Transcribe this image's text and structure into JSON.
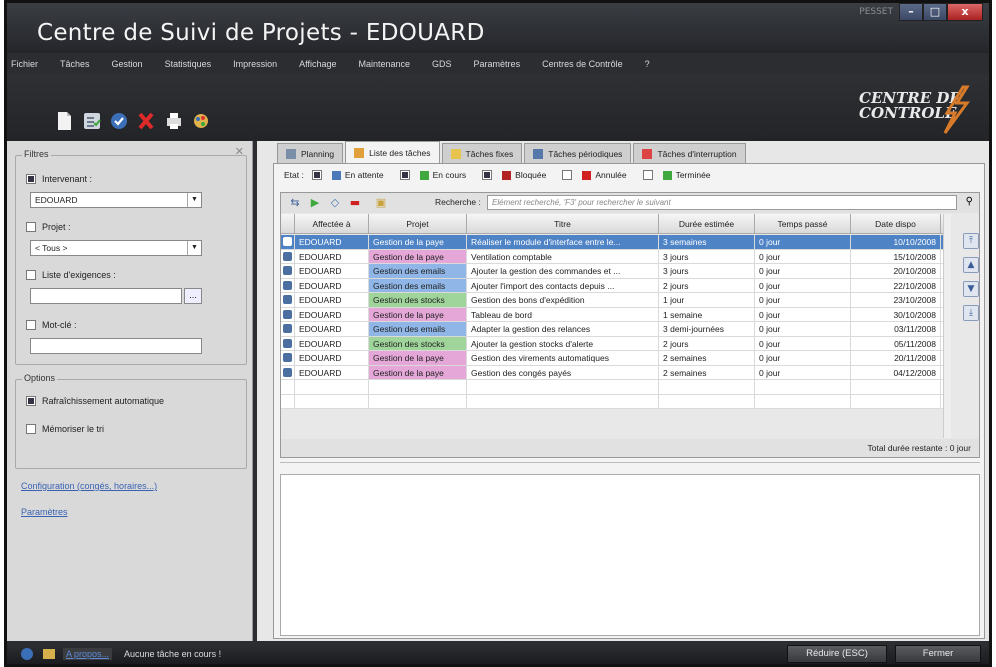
{
  "window": {
    "title": "Centre de Suivi de Projets - EDOUARD",
    "brand": "PESSET"
  },
  "menu": [
    "Fichier",
    "Tâches",
    "Gestion",
    "Statistiques",
    "Impression",
    "Affichage",
    "Maintenance",
    "GDS",
    "Paramètres",
    "Centres de Contrôle",
    "?"
  ],
  "toolbar": {
    "icons": [
      "new-document-icon",
      "validate-list-icon",
      "check-icon",
      "delete-icon",
      "print-icon",
      "settings-palette-icon"
    ],
    "logo_line1": "CENTRE DE",
    "logo_line2": "CONTROLE"
  },
  "filters": {
    "legend": "Filtres",
    "intervenant_label": "Intervenant :",
    "intervenant_checked": true,
    "intervenant_value": "EDOUARD",
    "projet_label": "Projet :",
    "projet_checked": false,
    "projet_value": "< Tous >",
    "exigences_label": "Liste d'exigences :",
    "exigences_checked": false,
    "exigences_browse": "...",
    "motcle_label": "Mot-clé :",
    "motcle_checked": false
  },
  "options": {
    "legend": "Options",
    "auto_refresh_label": "Rafraîchissement automatique",
    "auto_refresh_checked": true,
    "remember_sort_label": "Mémoriser le tri",
    "remember_sort_checked": false,
    "config_link": "Configuration (congés, horaires...)",
    "params_link": "Paramètres"
  },
  "tabs": [
    {
      "label": "Planning",
      "active": false
    },
    {
      "label": "Liste des tâches",
      "active": true
    },
    {
      "label": "Tâches fixes",
      "active": false
    },
    {
      "label": "Tâches périodiques",
      "active": false
    },
    {
      "label": "Tâches d'interruption",
      "active": false
    }
  ],
  "etat": {
    "label": "Etat :",
    "states": [
      {
        "label": "En attente",
        "checked": true,
        "color": "#4a78b8"
      },
      {
        "label": "En cours",
        "checked": true,
        "color": "#3fa83f"
      },
      {
        "label": "Bloquée",
        "checked": true,
        "color": "#b22222"
      },
      {
        "label": "Annulée",
        "checked": false,
        "color": "#d12020"
      },
      {
        "label": "Terminée",
        "checked": false,
        "color": "#3fa83f"
      }
    ]
  },
  "search": {
    "label": "Recherche :",
    "placeholder": "Elément recherché, 'F3' pour rechercher le suivant"
  },
  "grid": {
    "columns": [
      "Affectée à",
      "Projet",
      "Titre",
      "Durée estimée",
      "Temps passé",
      "Date dispo"
    ],
    "rows": [
      {
        "assignee": "EDOUARD",
        "projet": "Gestion de la paye",
        "titre": "Réaliser le module d'interface entre le...",
        "duree": "3 semaines",
        "temps": "0 jour",
        "date": "10/10/2008",
        "selected": true
      },
      {
        "assignee": "EDOUARD",
        "projet": "Gestion de la paye",
        "titre": "Ventilation comptable",
        "duree": "3 jours",
        "temps": "0 jour",
        "date": "15/10/2008",
        "selected": false
      },
      {
        "assignee": "EDOUARD",
        "projet": "Gestion des emails",
        "titre": "Ajouter la gestion des commandes et ...",
        "duree": "3 jours",
        "temps": "0 jour",
        "date": "20/10/2008",
        "selected": false
      },
      {
        "assignee": "EDOUARD",
        "projet": "Gestion des emails",
        "titre": "Ajouter l'import des contacts depuis ...",
        "duree": "2 jours",
        "temps": "0 jour",
        "date": "22/10/2008",
        "selected": false
      },
      {
        "assignee": "EDOUARD",
        "projet": "Gestion des stocks",
        "titre": "Gestion des bons d'expédition",
        "duree": "1 jour",
        "temps": "0 jour",
        "date": "23/10/2008",
        "selected": false
      },
      {
        "assignee": "EDOUARD",
        "projet": "Gestion de la paye",
        "titre": "Tableau de bord",
        "duree": "1 semaine",
        "temps": "0 jour",
        "date": "30/10/2008",
        "selected": false
      },
      {
        "assignee": "EDOUARD",
        "projet": "Gestion des emails",
        "titre": "Adapter la gestion des relances",
        "duree": "3 demi-journées",
        "temps": "0 jour",
        "date": "03/11/2008",
        "selected": false
      },
      {
        "assignee": "EDOUARD",
        "projet": "Gestion des stocks",
        "titre": "Ajouter la gestion stocks d'alerte",
        "duree": "2 jours",
        "temps": "0 jour",
        "date": "05/11/2008",
        "selected": false
      },
      {
        "assignee": "EDOUARD",
        "projet": "Gestion de la paye",
        "titre": "Gestion des virements automatiques",
        "duree": "2 semaines",
        "temps": "0 jour",
        "date": "20/11/2008",
        "selected": false
      },
      {
        "assignee": "EDOUARD",
        "projet": "Gestion de la paye",
        "titre": "Gestion des congés payés",
        "duree": "2 semaines",
        "temps": "0 jour",
        "date": "04/12/2008",
        "selected": false
      }
    ],
    "total": "Total durée restante : 0 jour"
  },
  "project_colors": {
    "Gestion de la paye": "#e4a7d8",
    "Gestion des emails": "#8fb6e6",
    "Gestion des stocks": "#9fd49a"
  },
  "statusbar": {
    "about": "A propos...",
    "status": "Aucune tâche en cours !",
    "reduce": "Réduire (ESC)",
    "close": "Fermer"
  }
}
